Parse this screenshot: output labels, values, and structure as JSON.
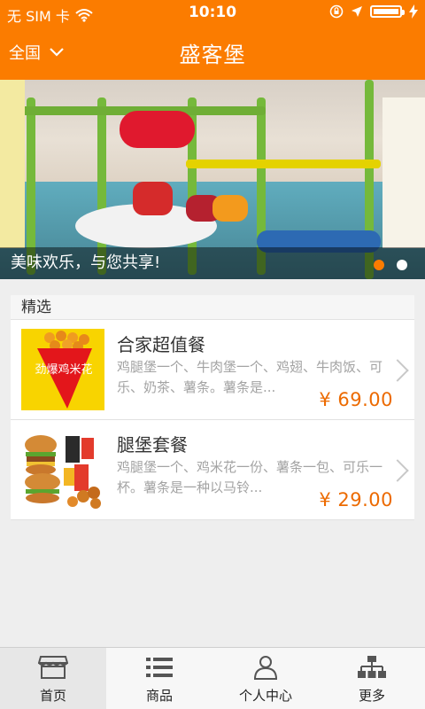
{
  "status": {
    "carrier": "无 SIM 卡",
    "time": "10:10",
    "icons": [
      "wifi-icon",
      "rotation-lock-icon",
      "location-arrow-icon",
      "battery-icon",
      "charging-icon"
    ]
  },
  "header": {
    "region": "全国",
    "title": "盛客堡"
  },
  "banner": {
    "caption": "美味欢乐，与您共享!",
    "slide_count": 2,
    "active_index": 0
  },
  "featured": {
    "heading": "精选",
    "items": [
      {
        "title": "合家超值餐",
        "desc": "鸡腿堡一个、牛肉堡一个、鸡翅、牛肉饭、可乐、奶茶、薯条。薯条是...",
        "price": "¥ 69.00",
        "thumb_text": "劲爆鸡米花"
      },
      {
        "title": "腿堡套餐",
        "desc": "鸡腿堡一个、鸡米花一份、薯条一包、可乐一杯。薯条是一种以马铃...",
        "price": "¥ 29.00"
      }
    ]
  },
  "tabs": [
    {
      "label": "首页",
      "icon": "store-icon",
      "active": true
    },
    {
      "label": "商品",
      "icon": "list-icon",
      "active": false
    },
    {
      "label": "个人中心",
      "icon": "user-icon",
      "active": false
    },
    {
      "label": "更多",
      "icon": "sitemap-icon",
      "active": false
    }
  ],
  "colors": {
    "brand": "#fb7c00",
    "price": "#ec6a00",
    "background": "#eeeeee"
  }
}
